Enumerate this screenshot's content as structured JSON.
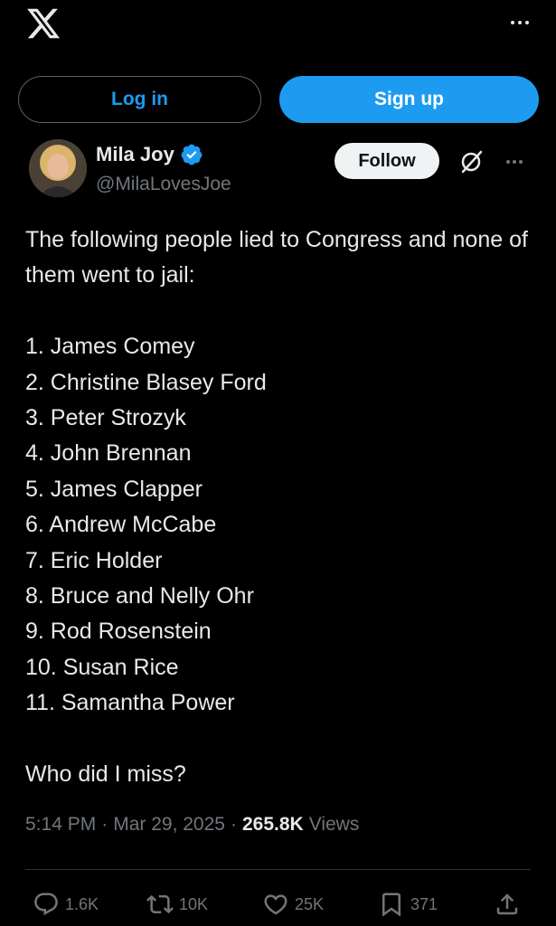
{
  "topbar": {
    "logo_icon": "x-logo-icon",
    "more_icon": "more-icon"
  },
  "auth": {
    "login_label": "Log in",
    "signup_label": "Sign up"
  },
  "author": {
    "name": "Mila Joy",
    "handle": "@MilaLovesJoe",
    "verified_icon": "verified-badge-icon",
    "follow_label": "Follow"
  },
  "tweet": {
    "intro": "The following people lied to Congress and none of them went to jail:",
    "list": [
      "1. James Comey",
      "2. Christine Blasey Ford",
      "3. Peter Strozyk",
      "4. John Brennan",
      "5. James Clapper",
      "6. Andrew McCabe",
      "7. Eric Holder",
      "8. Bruce and Nelly Ohr",
      "9. Rod Rosenstein",
      "10. Susan Rice",
      "11. Samantha Power"
    ],
    "closing": "Who did I miss?"
  },
  "meta": {
    "time": "5:14 PM",
    "date": "Mar 29, 2025",
    "sep": "·",
    "views_count": "265.8K",
    "views_label": "Views"
  },
  "actions": {
    "replies": "1.6K",
    "reposts": "10K",
    "likes": "25K",
    "bookmarks": "371"
  },
  "colors": {
    "accent": "#1d9bf0",
    "background": "#000000",
    "text": "#e7e9ea",
    "muted": "#71767b"
  }
}
